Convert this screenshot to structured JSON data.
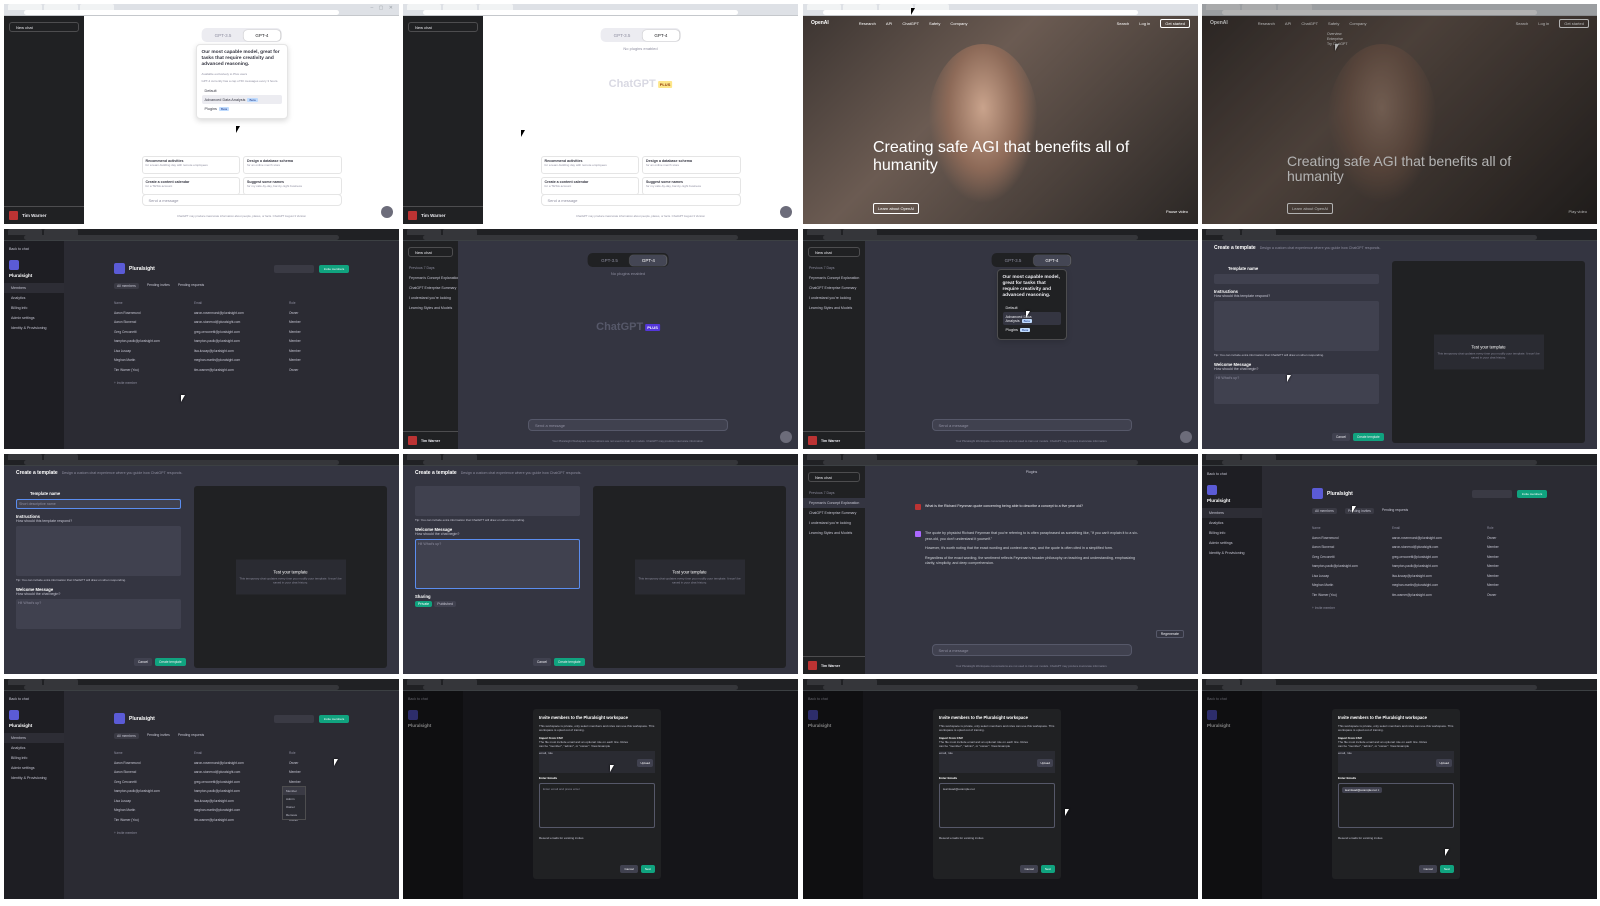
{
  "tiles": {
    "t1": {
      "new_chat": "New chat",
      "models": [
        "GPT-3.5",
        "GPT-4"
      ],
      "popup_title": "Our most capable model, great for tasks that require creativity and advanced reasoning.",
      "popup_note": "Available exclusively to Plus users",
      "popup_limit": "GPT-4 currently has a cap of 50 messages every 3 hours.",
      "options": [
        "Default",
        "Advanced Data Analysis",
        "Plugins"
      ],
      "beta": "Beta",
      "suggestions": [
        {
          "title": "Recommend activities",
          "sub": "for a team-building day with remote employees"
        },
        {
          "title": "Design a database schema",
          "sub": "for an online merch store"
        },
        {
          "title": "Create a content calendar",
          "sub": "for a TikTok account"
        },
        {
          "title": "Suggest some names",
          "sub": "for my cafe-by-day, bar-by-night business"
        }
      ],
      "placeholder": "Send a message",
      "disclaimer": "ChatGPT may produce inaccurate information about people, places, or facts. ChatGPT August 3 Version",
      "user": "Tim Warner"
    },
    "t2": {
      "no_plugins": "No plugins enabled",
      "logo": "ChatGPT",
      "plus": "PLUS"
    },
    "t3": {
      "brand": "OpenAI",
      "nav": [
        "Research",
        "API",
        "ChatGPT",
        "Safety",
        "Company"
      ],
      "search": "Search",
      "login": "Log in",
      "cta": "Get started",
      "hero": "Creating safe AGI that benefits all of humanity",
      "learn": "Learn about OpenAI",
      "pause": "Pause video"
    },
    "t4": {
      "submenu": [
        "Overview",
        "Enterprise",
        "Try ChatGPT"
      ],
      "play": "Play video"
    },
    "ps": {
      "back": "Back to chat",
      "org": "Pluralsight",
      "org_sub": "Enterprise · 7 members",
      "side_items": [
        "Members",
        "Analytics",
        "Billing info",
        "Admin settings",
        "Identity & Provisioning"
      ],
      "invite": "Invite members",
      "search": "Search",
      "tabs": [
        "All members",
        "Pending invites",
        "Pending requests"
      ],
      "headers": [
        "Name",
        "Email",
        "Role"
      ],
      "rows": [
        [
          "Aaron Rosenmund",
          "aaron-rosenmund@pluralsight.com",
          "Owner"
        ],
        [
          "Aaron Stonerod",
          "aaron-stonerod@pluralsight.com",
          "Member"
        ],
        [
          "Greg Cerconetti",
          "greg-cerconetti@pluralsight.com",
          "Member"
        ],
        [
          "hampton-paulk@pluralsight.com",
          "hampton-paulk@pluralsight.com",
          "Member"
        ],
        [
          "Lisa Luscap",
          "lisa-luscap@pluralsight.com",
          "Member"
        ],
        [
          "Meghan Martin",
          "meghan-martin@pluralsight.com",
          "Member"
        ],
        [
          "Tim Warner (You)",
          "tim-warner@pluralsight.com",
          "Owner"
        ]
      ],
      "invite_link": "+ Invite member",
      "roles_menu": [
        "Member",
        "Admin",
        "Owner",
        "Remove"
      ]
    },
    "tpl": {
      "title": "Create a template",
      "sub": "Design a custom chat experience where you guide how ChatGPT responds.",
      "name_label": "Template name",
      "name_ph": "Short descriptive name",
      "instr_label": "Instructions",
      "instr_q": "How should this template respond?",
      "tip": "Tip: You can include extra information that ChatGPT will draw on when responding.",
      "welcome_label": "Welcome Message",
      "welcome_q": "How should the chat begin?",
      "welcome_ph": "Hi! What's up?",
      "test_title": "Test your template",
      "test_sub": "This temporary chat updates every time you modify your template. It won't be saved in your chat history.",
      "sharing": "Sharing",
      "private": "Private",
      "published": "Published",
      "cancel": "Cancel",
      "create": "Create template",
      "msg_ph": "Send a message"
    },
    "hist": [
      "Feynman's Concept Explanation",
      "ChatGPT Enterprise Summary",
      "I understand you're looking",
      "Learning Styles and Models"
    ],
    "prev_days": "Previous 7 Days",
    "plugins_label": "Plugins",
    "chat": {
      "q": "What is the Richard Feynman quote concerning being able to describe a concept to a five year old?",
      "a1": "The quote by physicist Richard Feynman that you're referring to is often paraphrased as something like, \"If you can't explain it to a six-year-old, you don't understand it yourself.\"",
      "a2": "However, it's worth noting that the exact wording and context can vary, and the quote is often cited in a simplified form.",
      "a3": "Regardless of the exact wording, the sentiment reflects Feynman's broader philosophy on teaching and understanding, emphasizing clarity, simplicity, and deep comprehension.",
      "regen": "Regenerate",
      "footer": "Your Pluralsight Workspace conversations are not used to train our models. ChatGPT may produce inaccurate information."
    },
    "modal": {
      "title": "Invite members to the Pluralsight workspace",
      "desc": "This workspace is private, only select members and roles can use this workspace. This workspace is opted out of training.",
      "csv_label": "Import from CSV",
      "csv_desc": "The file must include email and an optional role on each line. Roles can be \"member\", \"admin\", or \"owner\". View Example",
      "upload": "Upload",
      "csv_sample": "email, role",
      "enter_label": "Enter Emails",
      "enter_ph": "Enter email and press enter",
      "typed": "learnlead@example.net",
      "resend": "Resend emails for existing invites",
      "cancel": "Cancel",
      "next": "Next"
    }
  }
}
